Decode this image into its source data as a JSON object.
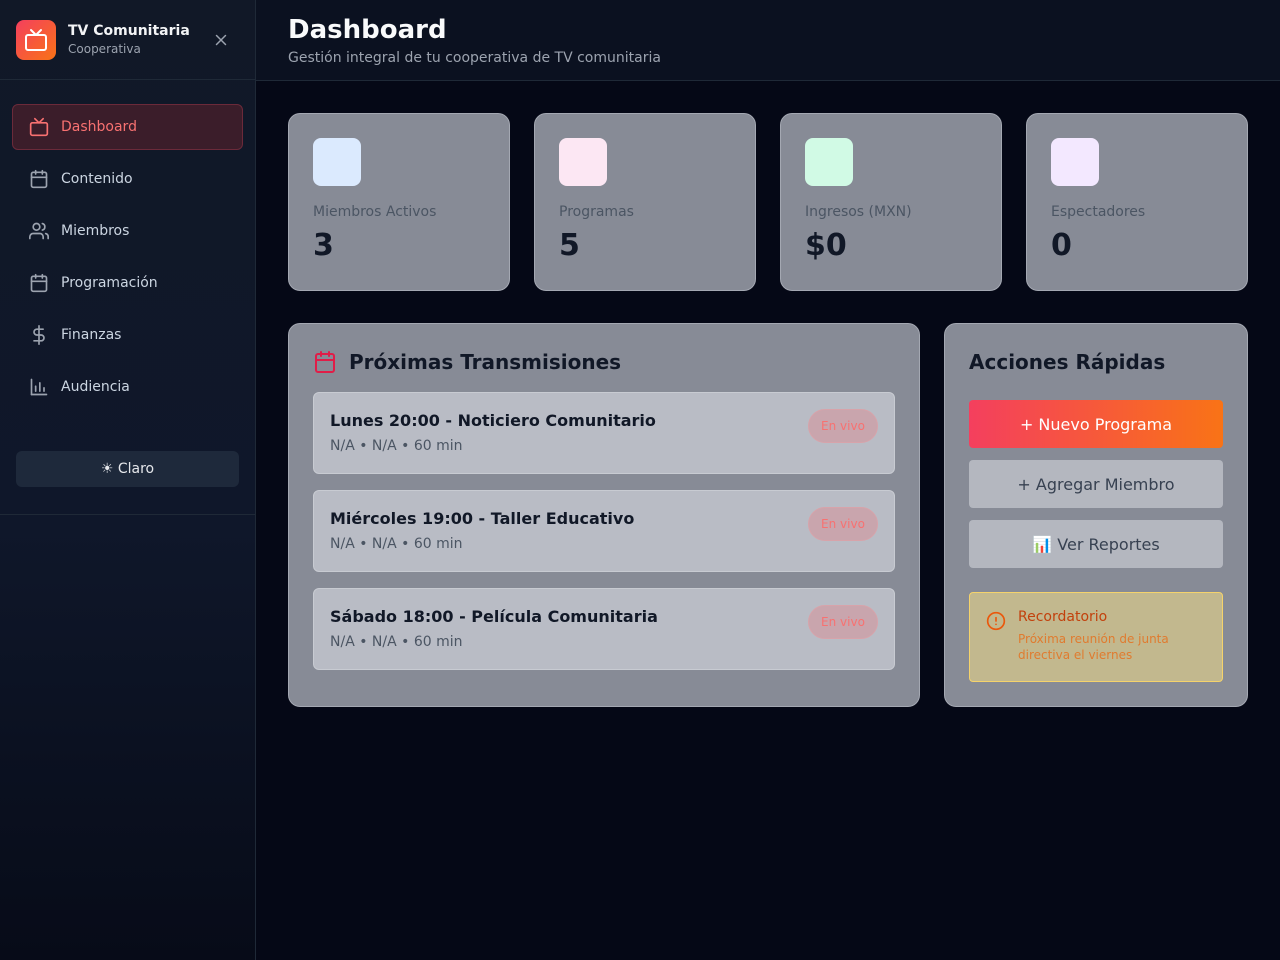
{
  "sidebar": {
    "brand_title": "TV Comunitaria",
    "brand_subtitle": "Cooperativa",
    "items": [
      {
        "label": "Dashboard",
        "icon": "tv-icon",
        "active": true
      },
      {
        "label": "Contenido",
        "icon": "calendar-icon"
      },
      {
        "label": "Miembros",
        "icon": "users-icon"
      },
      {
        "label": "Programación",
        "icon": "calendar-icon"
      },
      {
        "label": "Finanzas",
        "icon": "dollar-icon"
      },
      {
        "label": "Audiencia",
        "icon": "bar-chart-icon"
      }
    ],
    "theme_label": "☀ Claro"
  },
  "header": {
    "title": "Dashboard",
    "subtitle": "Gestión integral de tu cooperativa de TV comunitaria"
  },
  "stats": [
    {
      "label": "Miembros Activos",
      "value": "3",
      "color": "#dbeafe"
    },
    {
      "label": "Programas",
      "value": "5",
      "color": "#fce7f3"
    },
    {
      "label": "Ingresos (MXN)",
      "value": "$0",
      "color": "#d1fae5"
    },
    {
      "label": "Espectadores",
      "value": "0",
      "color": "#f3e8ff"
    }
  ],
  "broadcasts": {
    "title": "Próximas Transmisiones",
    "items": [
      {
        "title": "Lunes 20:00 - Noticiero Comunitario",
        "meta": "N/A • N/A • 60 min",
        "badge": "En vivo"
      },
      {
        "title": "Miércoles 19:00 - Taller Educativo",
        "meta": "N/A • N/A • 60 min",
        "badge": "En vivo"
      },
      {
        "title": "Sábado 18:00 - Película Comunitaria",
        "meta": "N/A • N/A • 60 min",
        "badge": "En vivo"
      }
    ]
  },
  "quick_actions": {
    "title": "Acciones Rápidas",
    "new_program": "+ Nuevo Programa",
    "add_member": "+ Agregar Miembro",
    "view_reports": "📊 Ver Reportes",
    "reminder_title": "Recordatorio",
    "reminder_text": "Próxima reunión de junta directiva el viernes"
  },
  "colors": {
    "accent_start": "#f43f5e",
    "accent_end": "#f97316",
    "active_nav": "#f87171"
  }
}
